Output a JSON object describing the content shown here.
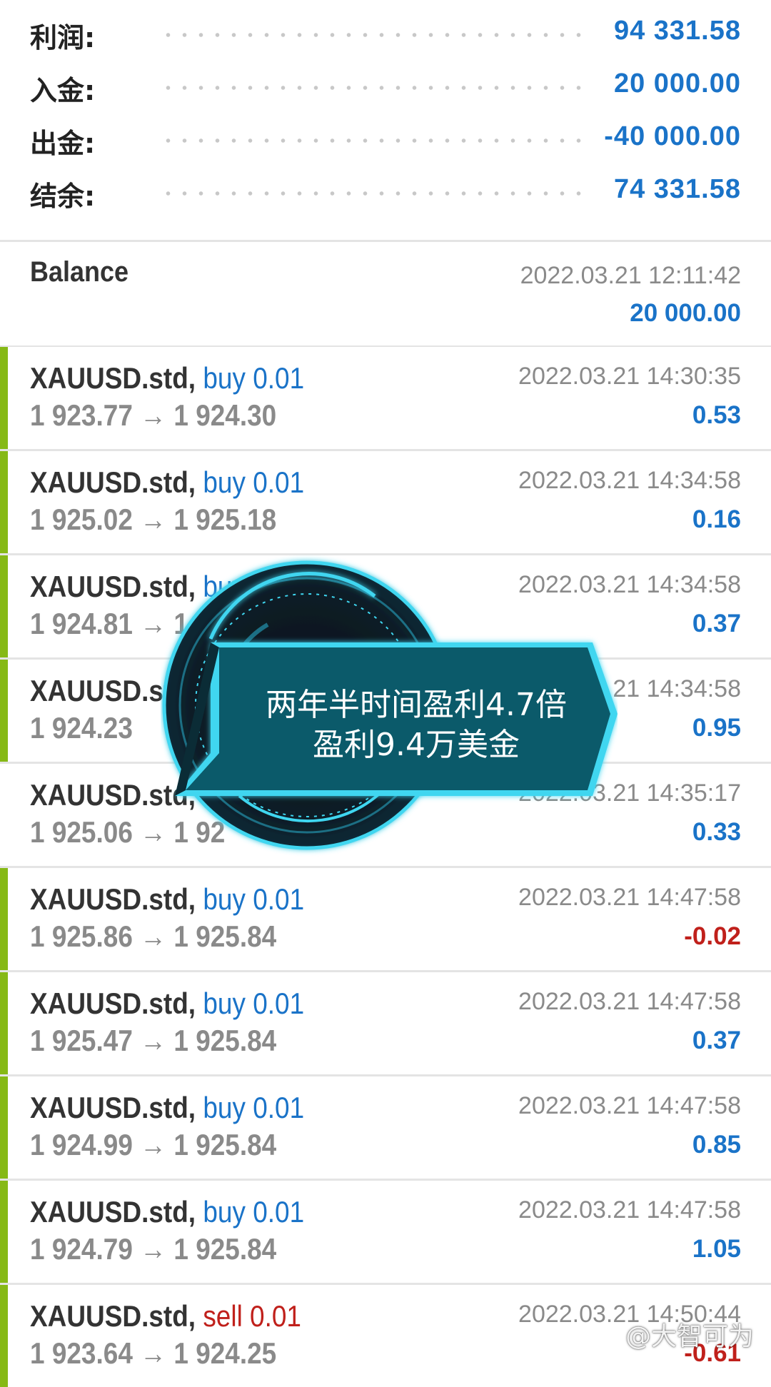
{
  "summary": {
    "profit": {
      "label": "利润:",
      "value": "94 331.58"
    },
    "deposit": {
      "label": "入金:",
      "value": "20 000.00"
    },
    "withdrawal": {
      "label": "出金:",
      "value": "-40 000.00"
    },
    "balance": {
      "label": "结余:",
      "value": "74 331.58"
    }
  },
  "balance_entry": {
    "title": "Balance",
    "time": "2022.03.21 12:11:42",
    "amount": "20 000.00"
  },
  "trades": [
    {
      "symbol": "XAUUSD.std,",
      "direction": "buy 0.01",
      "prices": "1 923.77 → 1 924.30",
      "time": "2022.03.21 14:30:35",
      "profit": "0.53"
    },
    {
      "symbol": "XAUUSD.std,",
      "direction": "buy 0.01",
      "prices": "1 925.02 → 1 925.18",
      "time": "2022.03.21 14:34:58",
      "profit": "0.16"
    },
    {
      "symbol": "XAUUSD.std,",
      "direction": "buy 0.01",
      "prices": "1 924.81 → 1",
      "time": "2022.03.21 14:34:58",
      "profit": "0.37"
    },
    {
      "symbol": "XAUUSD.std",
      "direction": "",
      "prices": "1 924.23",
      "time": "2022.03.21 14:34:58",
      "profit": "0.95"
    },
    {
      "symbol": "XAUUSD.std,",
      "direction": "",
      "prices": "1 925.06 → 1 92",
      "time": "2022.03.21 14:35:17",
      "profit": "0.33"
    },
    {
      "symbol": "XAUUSD.std,",
      "direction": "buy 0.01",
      "prices": "1 925.86 → 1 925.84",
      "time": "2022.03.21 14:47:58",
      "profit": "-0.02"
    },
    {
      "symbol": "XAUUSD.std,",
      "direction": "buy 0.01",
      "prices": "1 925.47 → 1 925.84",
      "time": "2022.03.21 14:47:58",
      "profit": "0.37"
    },
    {
      "symbol": "XAUUSD.std,",
      "direction": "buy 0.01",
      "prices": "1 924.99 → 1 925.84",
      "time": "2022.03.21 14:47:58",
      "profit": "0.85"
    },
    {
      "symbol": "XAUUSD.std,",
      "direction": "buy 0.01",
      "prices": "1 924.79 → 1 925.84",
      "time": "2022.03.21 14:47:58",
      "profit": "1.05"
    },
    {
      "symbol": "XAUUSD.std,",
      "direction": "sell 0.01",
      "prices": "1 923.64 → 1 924.25",
      "time": "2022.03.21 14:50:44",
      "profit": "-0.61"
    }
  ],
  "overlay": {
    "line1": "两年半时间盈利4.7倍",
    "line2": "盈利9.4万美金"
  },
  "watermark": "@大智可为",
  "colors": {
    "positive": "#1a73c8",
    "negative": "#c0201b",
    "buy_bar": "#86b916",
    "overlay_fill": "#0b5a6a",
    "overlay_glow": "#3fd6f0"
  }
}
